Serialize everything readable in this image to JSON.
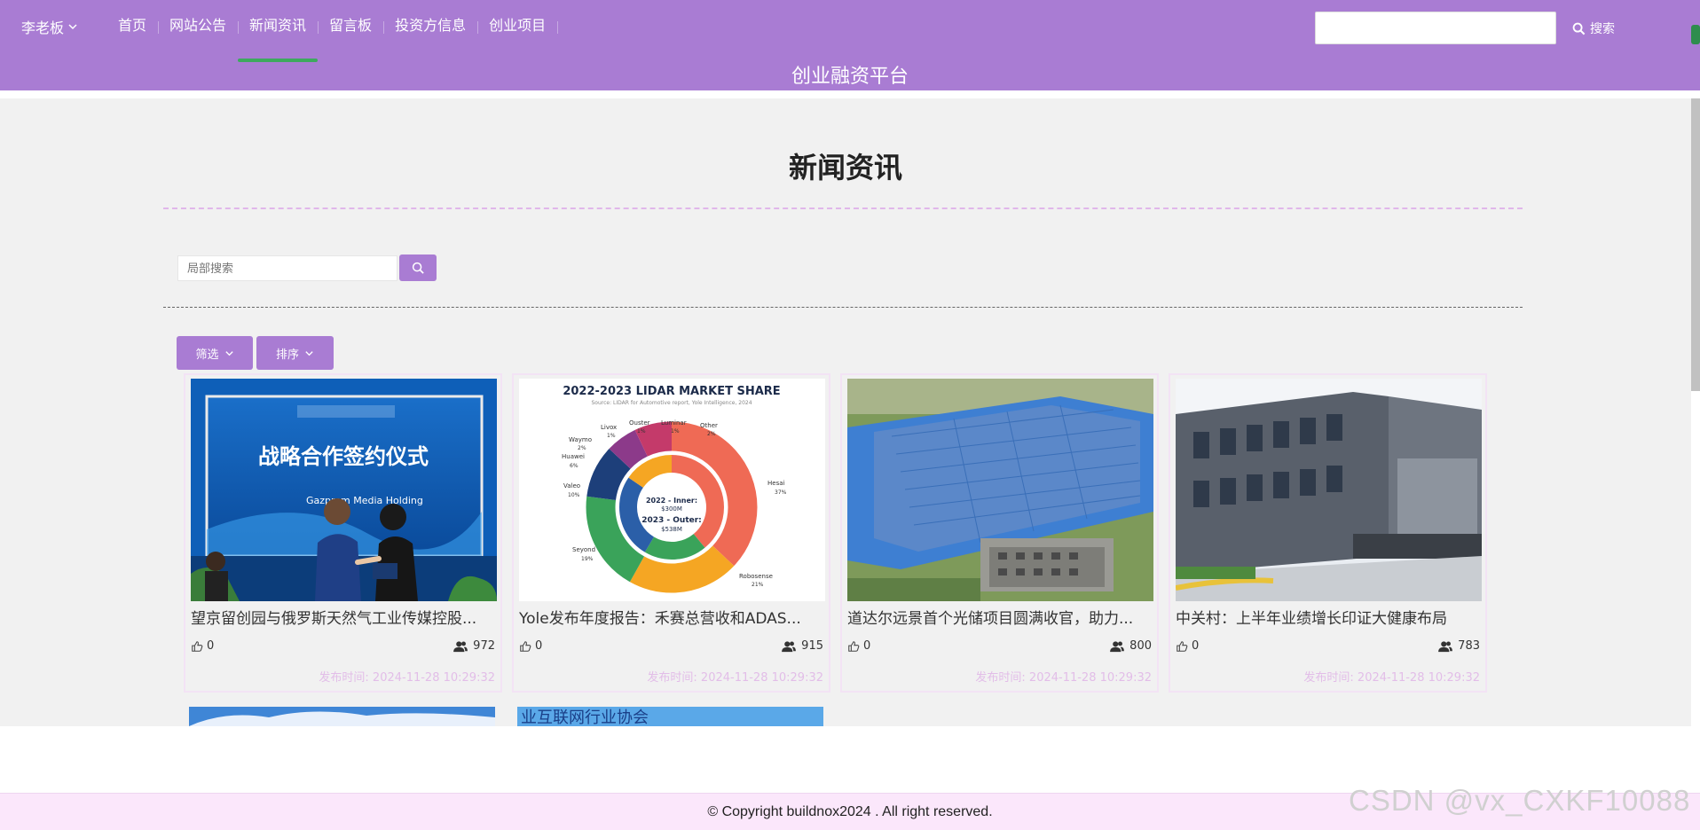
{
  "header": {
    "user_label": "李老板",
    "nav": [
      {
        "label": "首页",
        "active": false
      },
      {
        "label": "网站公告",
        "active": false
      },
      {
        "label": "新闻资讯",
        "active": true
      },
      {
        "label": "留言板",
        "active": false
      },
      {
        "label": "投资方信息",
        "active": false
      },
      {
        "label": "创业项目",
        "active": false
      }
    ],
    "site_title": "创业融资平台",
    "search_value": "",
    "search_button": "搜索"
  },
  "main": {
    "page_title": "新闻资讯",
    "local_search_placeholder": "局部搜索",
    "filter_label": "筛选",
    "sort_label": "排序",
    "cards": [
      {
        "title": "望京留创园与俄罗斯天然气工业传媒控股...",
        "likes": "0",
        "views": "972",
        "date_label": "发布时间: 2024-11-28 10:29:32",
        "image": "signing-ceremony",
        "image_text": "战略合作签约仪式",
        "image_subtext": "Gazprom Media Holding"
      },
      {
        "title": "Yole发布年度报告：禾赛总营收和ADAS...",
        "likes": "0",
        "views": "915",
        "date_label": "发布时间: 2024-11-28 10:29:32",
        "image": "lidar-market-share-chart",
        "image_text": "2022-2023 LIDAR MARKET SHARE",
        "image_subtext": "Source: LIDAR for Automotive report, Yole Intelligence, 2024"
      },
      {
        "title": "道达尔远景首个光储项目圆满收官，助力...",
        "likes": "0",
        "views": "800",
        "date_label": "发布时间: 2024-11-28 10:29:32",
        "image": "solar-roof-aerial",
        "image_text": "",
        "image_subtext": ""
      },
      {
        "title": "中关村：上半年业绩增长印证大健康布局",
        "likes": "0",
        "views": "783",
        "date_label": "发布时间: 2024-11-28 10:29:32",
        "image": "factory-building",
        "image_text": "",
        "image_subtext": ""
      }
    ],
    "partial_cards": [
      {
        "image": "building-sky"
      },
      {
        "image": "banner-blue",
        "image_text": "业互联网行业协会"
      }
    ]
  },
  "lidar_labels": {
    "center_a": "2022 - Inner:",
    "center_b": "$300M",
    "center_c": "2023 - Outer:",
    "center_d": "$538M",
    "hesai": "Hesai",
    "hesai_pct": "37%",
    "robosense": "Robosense",
    "robosense_pct": "21%",
    "seyond": "Seyond",
    "seyond_pct": "19%",
    "valeo": "Valeo",
    "valeo_pct": "10%",
    "huawei": "Huawei",
    "huawei_pct": "6%",
    "waymo": "Waymo",
    "waymo_pct": "2%",
    "livox": "Livox",
    "livox_pct": "1%",
    "ouster": "Ouster",
    "ouster_pct": "1%",
    "luminar": "Luminar",
    "luminar_pct": "1%",
    "other": "Other",
    "other_pct": "2%"
  },
  "footer": {
    "copyright": "© Copyright buildnox2024 . All right reserved.",
    "watermark": "CSDN @vx_CXKF10088"
  },
  "colors": {
    "header_bg": "#a97cd3",
    "nav_active_underline": "#3da95e",
    "main_bg": "#f1f1f1",
    "footer_bg": "#fbe7fb",
    "date_text": "#e2bde8"
  }
}
